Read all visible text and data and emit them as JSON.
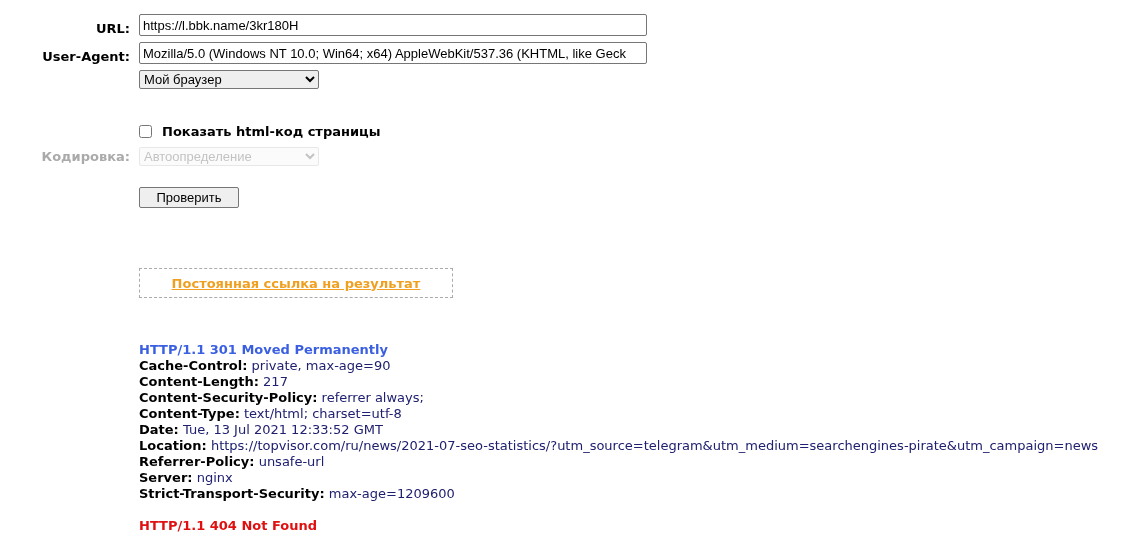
{
  "form": {
    "url": {
      "label": "URL:",
      "value": "https://l.bbk.name/3kr180H"
    },
    "user_agent": {
      "label": "User-Agent:",
      "value": "Mozilla/5.0 (Windows NT 10.0; Win64; x64) AppleWebKit/537.36 (KHTML, like Geck",
      "preset": "Мой браузер"
    },
    "show_html": {
      "label": "Показать html-код страницы",
      "checked": false
    },
    "encoding": {
      "label": "Кодировка:",
      "value": "Автоопределение",
      "disabled": true
    },
    "submit": "Проверить"
  },
  "permalink": "Постоянная ссылка на результат",
  "responses": [
    {
      "status": "HTTP/1.1 301 Moved Permanently",
      "color": "#3a5fe0",
      "headers": [
        {
          "name": "Cache-Control:",
          "value": "private, max-age=90"
        },
        {
          "name": "Content-Length:",
          "value": "217"
        },
        {
          "name": "Content-Security-Policy:",
          "value": "referrer always;"
        },
        {
          "name": "Content-Type:",
          "value": "text/html; charset=utf-8"
        },
        {
          "name": "Date:",
          "value": "Tue, 13 Jul 2021 12:33:52 GMT"
        },
        {
          "name": "Location:",
          "value": "https://topvisor.com/ru/news/2021-07-seo-statistics/?utm_source=telegram&utm_medium=searchengines-pirate&utm_campaign=news"
        },
        {
          "name": "Referrer-Policy:",
          "value": "unsafe-url"
        },
        {
          "name": "Server:",
          "value": "nginx"
        },
        {
          "name": "Strict-Transport-Security:",
          "value": "max-age=1209600"
        }
      ]
    },
    {
      "status": "HTTP/1.1 404 Not Found",
      "color": "#e01010"
    }
  ]
}
